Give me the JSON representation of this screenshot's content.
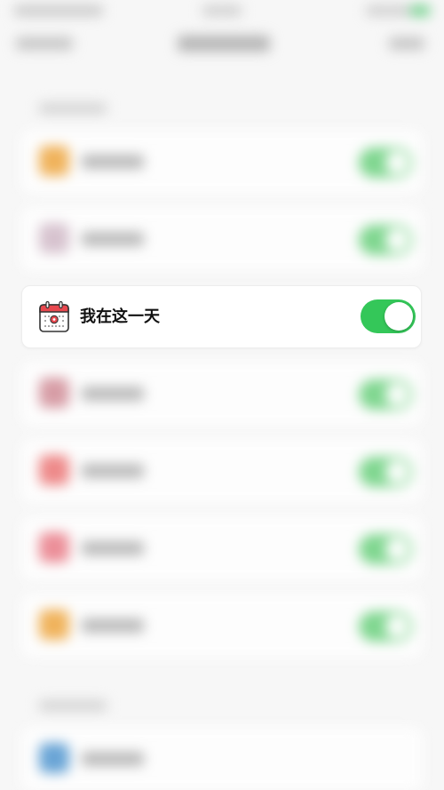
{
  "focused_item": {
    "label": "我在这一天",
    "icon": "calendar-icon",
    "toggle_on": true
  },
  "colors": {
    "toggle_on": "#34c759",
    "calendar_red": "#e8484f",
    "background": "#f7f7f7"
  },
  "blurred_rows": [
    {
      "icon_color": "#f0b35c",
      "toggle_on": true
    },
    {
      "icon_color": "#d7c3cf",
      "toggle_on": true
    },
    {
      "icon_color": "#d79da6",
      "toggle_on": true
    },
    {
      "icon_color": "#ee8a8a",
      "toggle_on": true
    },
    {
      "icon_color": "#ec8f99",
      "toggle_on": true
    },
    {
      "icon_color": "#f0b35c",
      "toggle_on": true
    },
    {
      "icon_color": "#6aa5d6",
      "toggle_on": false
    }
  ]
}
